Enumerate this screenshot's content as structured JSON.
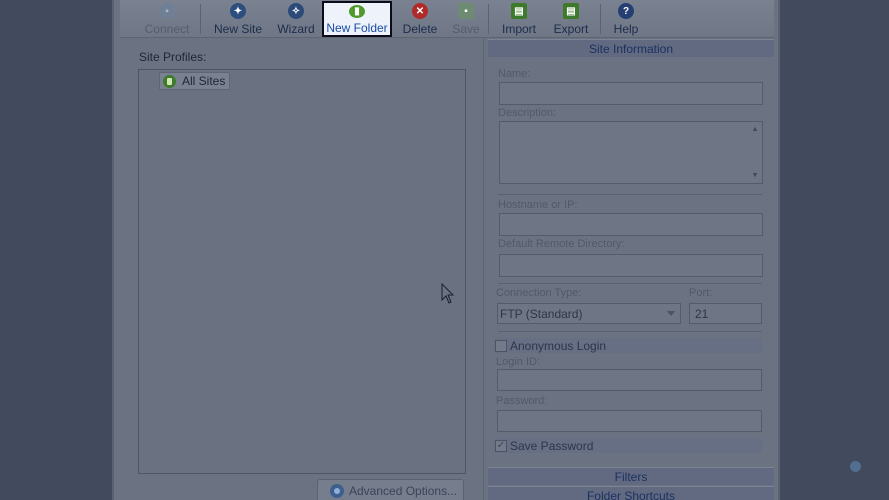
{
  "toolbar": {
    "buttons": [
      {
        "label": "Connect",
        "icon": "connect-icon",
        "enabled": false
      },
      {
        "label": "New Site",
        "icon": "new-site-icon",
        "enabled": true
      },
      {
        "label": "Wizard",
        "icon": "wizard-icon",
        "enabled": true
      },
      {
        "label": "New Folder",
        "icon": "new-folder-icon",
        "enabled": true,
        "highlighted": true
      },
      {
        "label": "Delete",
        "icon": "delete-icon",
        "enabled": true
      },
      {
        "label": "Save",
        "icon": "save-icon",
        "enabled": false
      },
      {
        "label": "Import",
        "icon": "import-icon",
        "enabled": true
      },
      {
        "label": "Export",
        "icon": "export-icon",
        "enabled": true
      },
      {
        "label": "Help",
        "icon": "help-icon",
        "enabled": true
      }
    ]
  },
  "site_profiles": {
    "label": "Site Profiles:",
    "tree": [
      {
        "label": "All Sites",
        "icon": "all-sites-icon"
      }
    ],
    "advanced_button": "Advanced Options..."
  },
  "site_info": {
    "header": "Site Information",
    "name_label": "Name:",
    "name_value": "",
    "description_label": "Description:",
    "description_value": "",
    "hostname_label": "Hostname or IP:",
    "hostname_value": "",
    "remote_dir_label": "Default Remote Directory:",
    "remote_dir_value": "",
    "connection_type_label": "Connection Type:",
    "connection_type_value": "FTP (Standard)",
    "port_label": "Port:",
    "port_value": "21",
    "anonymous_label": "Anonymous Login",
    "anonymous_checked": false,
    "login_label": "Login ID:",
    "login_value": "",
    "password_label": "Password:",
    "password_value": "",
    "save_password_label": "Save Password",
    "save_password_checked": true
  },
  "collapsed_sections": {
    "filters": "Filters",
    "folder_shortcuts": "Folder Shortcuts"
  },
  "colors": {
    "accent": "#1a4ba8",
    "section_header_text": "#1c3060",
    "tree_icon": "#3f7a2d",
    "delete_icon": "#b02a2a"
  }
}
